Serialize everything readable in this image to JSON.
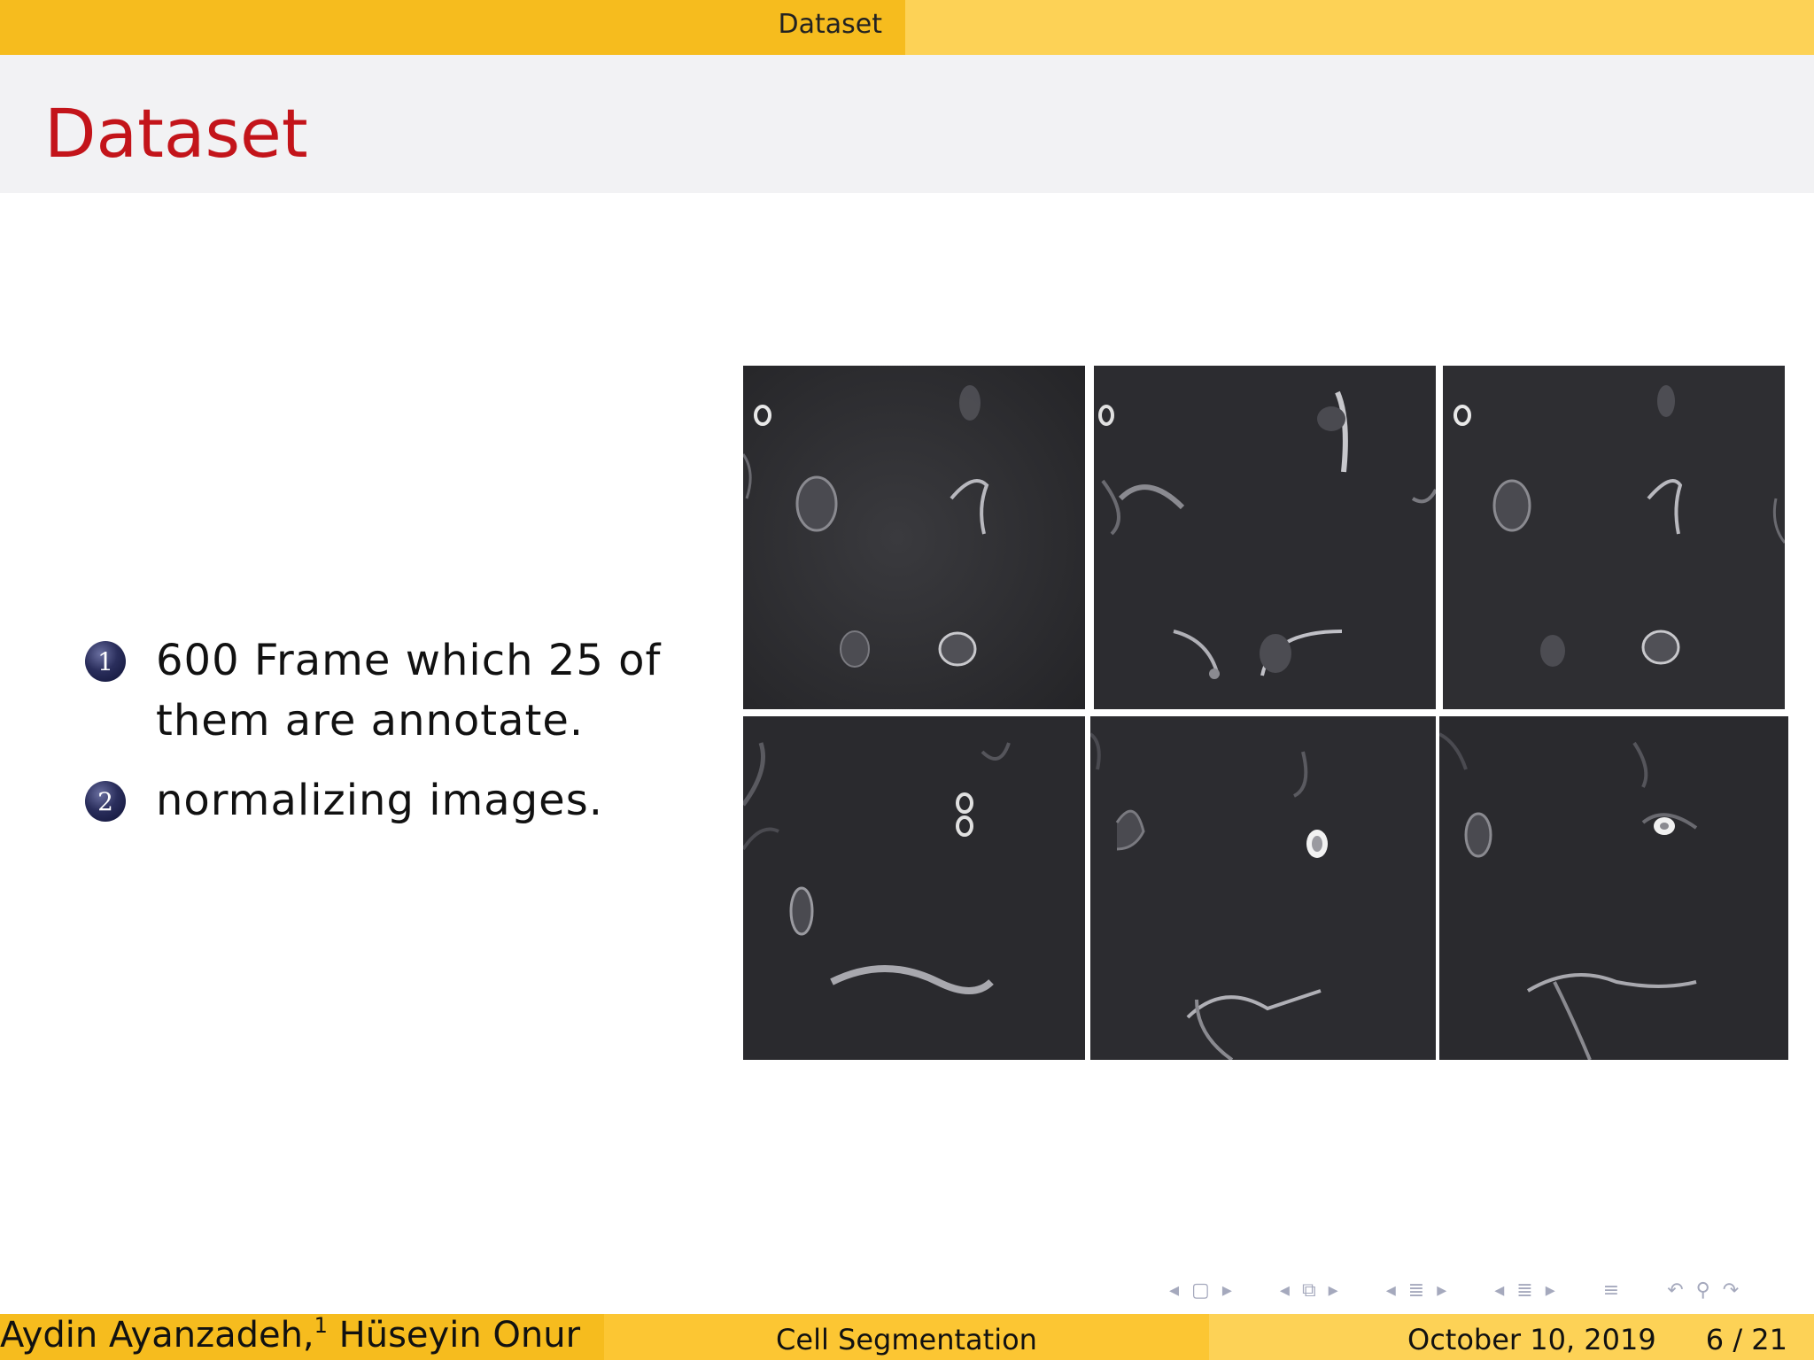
{
  "header": {
    "section_label": "Dataset"
  },
  "frame": {
    "title": "Dataset"
  },
  "content": {
    "items": [
      {
        "number": "1",
        "text_line1": "600 Frame which 25 of",
        "text_line2": "them are annotate."
      },
      {
        "number": "2",
        "text_line1": "normalizing images.",
        "text_line2": ""
      }
    ],
    "image_grid": {
      "rows": 2,
      "cols": 3,
      "tile_count": 6,
      "description": "grayscale phase-contrast cell microscopy frames"
    }
  },
  "navigation": {
    "icons": [
      "arrow-left-icon",
      "frame-icon",
      "arrow-right-icon",
      "arrow-left-icon",
      "subsection-icon",
      "arrow-right-icon",
      "arrow-left-icon",
      "section-icon",
      "arrow-right-icon",
      "arrow-left-icon",
      "document-icon",
      "arrow-right-icon",
      "align-icon",
      "back-icon",
      "search-icon",
      "forward-icon"
    ]
  },
  "footer": {
    "author": "Aydin Ayanzadeh,",
    "author_sup": "1",
    "author_2": "Hüseyin Onur",
    "title": "Cell Segmentation",
    "date": "October 10, 2019",
    "page": "6 / 21"
  },
  "colors": {
    "accent_dark": "#f6bc1e",
    "accent_light": "#fdd256",
    "title_red": "#c3141a",
    "enum_ball": "#1f2350"
  }
}
